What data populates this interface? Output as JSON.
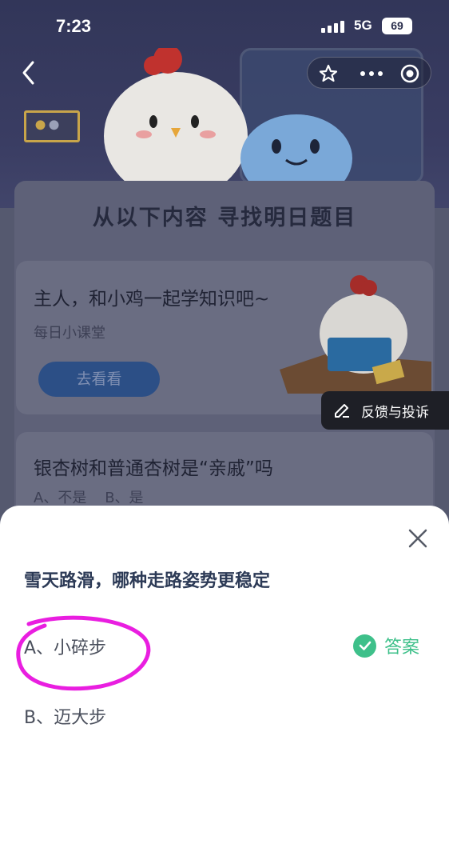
{
  "status_bar": {
    "time": "7:23",
    "network": "5G",
    "battery": "69"
  },
  "nav": {
    "back_icon": "chevron-left-icon",
    "actions": [
      "star-icon",
      "more-icon",
      "target-icon"
    ]
  },
  "panel": {
    "title": "从以下内容 寻找明日题目"
  },
  "card_lesson": {
    "title": "主人，和小鸡一起学知识吧~",
    "subtitle": "每日小课堂",
    "button_label": "去看看"
  },
  "feedback": {
    "label": "反馈与投诉",
    "icon": "edit-icon"
  },
  "card_quiz": {
    "title": "银杏树和普通杏树是“亲戚”吗",
    "options": "A、不是    B、是"
  },
  "sheet": {
    "question": "雪天路滑，哪种走路姿势更稳定",
    "option_a": "A、小碎步",
    "option_b": "B、迈大步",
    "answer_label": "答案",
    "colors": {
      "answer": "#3ec08a",
      "highlight_circle": "#e91ee0"
    }
  }
}
